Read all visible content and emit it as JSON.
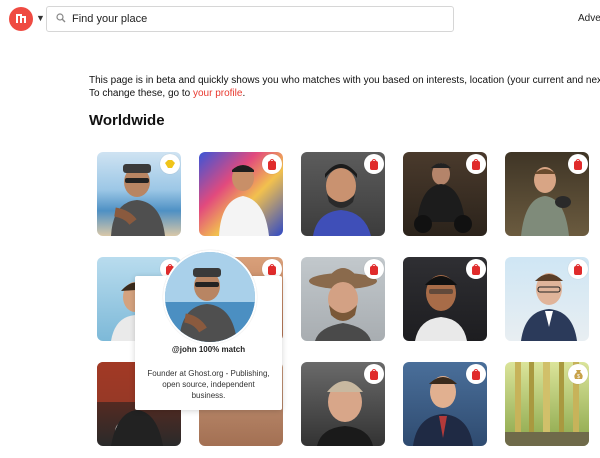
{
  "topbar": {
    "search_placeholder": "Find your place",
    "nav_label": "Adve"
  },
  "intro": {
    "line1": "This page is in beta and quickly shows you who matches with you based on interests, location (your current and next tr",
    "line2_prefix": "To change these, go to ",
    "profile_link": "your profile",
    "line2_suffix": "."
  },
  "section_title": "Worldwide",
  "colors": {
    "brand": "#ef4b42",
    "link": "#e8392f",
    "backpack_badge": "#e02b2b",
    "handshake_badge": "#f0c419",
    "money_badge": "#c8a24a"
  },
  "tiles": [
    {
      "name": "tile-1",
      "badge": "handshake-icon"
    },
    {
      "name": "tile-2",
      "badge": "backpack-icon"
    },
    {
      "name": "tile-3",
      "badge": "backpack-icon"
    },
    {
      "name": "tile-4",
      "badge": "backpack-icon"
    },
    {
      "name": "tile-5",
      "badge": "backpack-icon"
    },
    {
      "name": "tile-6",
      "badge": "backpack-icon"
    },
    {
      "name": "tile-7",
      "badge": "backpack-icon"
    },
    {
      "name": "tile-8",
      "badge": "backpack-icon"
    },
    {
      "name": "tile-9",
      "badge": "backpack-icon"
    },
    {
      "name": "tile-10",
      "badge": "backpack-icon"
    },
    {
      "name": "tile-11",
      "badge": "none"
    },
    {
      "name": "tile-12",
      "badge": "none"
    },
    {
      "name": "tile-13",
      "badge": "backpack-icon"
    },
    {
      "name": "tile-14",
      "badge": "backpack-icon"
    },
    {
      "name": "tile-15",
      "badge": "money-bag-icon"
    }
  ],
  "popover": {
    "title": "@john 100% match",
    "bio": "Founder at Ghost.org - Publishing, open source, independent business."
  }
}
